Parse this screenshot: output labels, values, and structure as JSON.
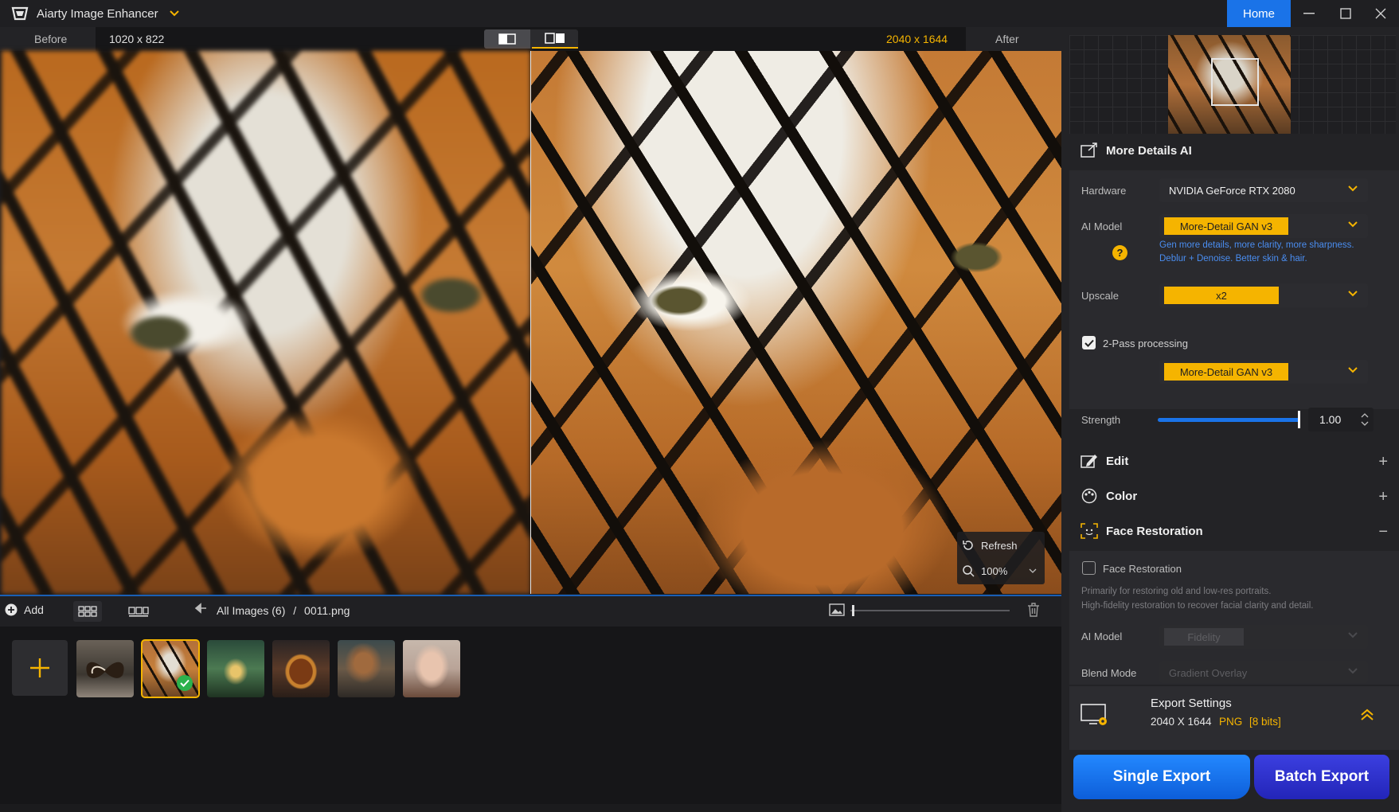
{
  "app": {
    "title": "Aiarty Image Enhancer",
    "home_label": "Home"
  },
  "compare": {
    "before_label": "Before",
    "before_size": "1020 x 822",
    "after_size": "2040 x 1644",
    "after_label": "After"
  },
  "viewer": {
    "refresh_label": "Refresh",
    "zoom_value": "100%"
  },
  "toolbar": {
    "add_label": "Add",
    "breadcrumb_all": "All Images (6)",
    "breadcrumb_sep": "/",
    "breadcrumb_file": "0011.png"
  },
  "thumbnails": [
    {
      "name": "butterfly",
      "selected": false
    },
    {
      "name": "tiger",
      "selected": true
    },
    {
      "name": "fairy-lantern",
      "selected": false
    },
    {
      "name": "burger",
      "selected": false
    },
    {
      "name": "dog-goggles",
      "selected": false
    },
    {
      "name": "portrait-woman",
      "selected": false
    }
  ],
  "panel": {
    "more_details": {
      "title": "More Details AI",
      "hardware_label": "Hardware",
      "hardware_value": "NVIDIA GeForce RTX 2080",
      "ai_model_label": "AI Model",
      "ai_model_value": "More-Detail GAN  v3",
      "ai_model_desc_1": "Gen more details, more clarity, more sharpness.",
      "ai_model_desc_2": "Deblur + Denoise. Better skin & hair.",
      "upscale_label": "Upscale",
      "upscale_value": "x2",
      "two_pass_label": "2-Pass processing",
      "two_pass_checked": true,
      "two_pass_model": "More-Detail GAN  v3",
      "strength_label": "Strength",
      "strength_value": "1.00"
    },
    "edit_title": "Edit",
    "color_title": "Color",
    "face": {
      "title": "Face Restoration",
      "checkbox_label": "Face Restoration",
      "checked": false,
      "desc_1": "Primarily for restoring old and low-res portraits.",
      "desc_2": "High-fidelity restoration to recover facial clarity and detail.",
      "ai_model_label": "AI Model",
      "ai_model_value": "Fidelity",
      "blend_label": "Blend Mode",
      "blend_value": "Gradient Overlay"
    },
    "export": {
      "title": "Export Settings",
      "dims": "2040 X 1644",
      "format": "PNG",
      "bits": "[8 bits]"
    },
    "single_export": "Single Export",
    "batch_export": "Batch Export"
  },
  "colors": {
    "accent": "#f5b400",
    "primary": "#1a73e8",
    "batch": "#2a2cc8"
  }
}
